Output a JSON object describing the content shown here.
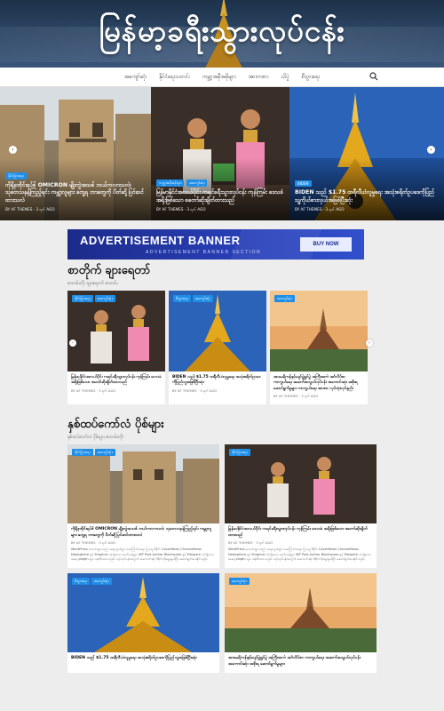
{
  "site": {
    "title": "မြန်မာ့ခရီးသွားလုပ်ငန်း"
  },
  "nav": {
    "items": [
      "အကျော်ဆုံး",
      "နိုင်ငံရေးသတင်း",
      "ကမ္ဘာ့အမှီအခိုများ",
      "အားကစား",
      "သိပ္ပံ",
      "စီးပွားရေး"
    ]
  },
  "slider": {
    "slides": [
      {
        "tags": [
          "နိုင်ငံခြားရေး"
        ],
        "title": "ကိုရိုနာဗိုင်းရပ်စ် OMICRON မျိုးကွဲအသစ် ဘယ်ကလာသလဲ၊ သုတေသနနဲ့ကြည့်ရင်း ကမ္ဘာ့လူများ တွေ့ရ ဘာတွေကို ပိတ်ဆို့ပြင်ဆင်ထားသလဲ",
        "meta": "BY AF THEMES · 3 ရက် AGO"
      },
      {
        "tags": [
          "ကမ္ဘာ့အမှီအခိုများ",
          "အကျော်ဆုံး"
        ],
        "title": "မြန်မာနိုင်ငံအလယ်ပိုင်း ကရင်ခရီးသွားလုပ်ငန်း ကုန်ကြမ်း ဒေသခံ အရိုးဖြစ်သော စတော်ဆိုးချိတ်ထားသည်",
        "meta": "BY AF THEMES · 3 ရက် AGO"
      },
      {
        "tags": [
          "BIDEN"
        ],
        "title": "BIDEN သည် $1.75 ထရီလီယံလူမှုရေး အသုံးစရိတ်ဥပဒေကိုပြည်သူ့ကိုယ်စားလှယ်အဖြစ်ပြီးဆုံး",
        "meta": "BY AF THEMES · 3 ရက် AGO"
      }
    ]
  },
  "ad": {
    "heading": "ADVERTISEMENT BANNER",
    "sub": "ADVERTISEMENT BANNER SECTION",
    "button": "BUY NOW"
  },
  "trending": {
    "title": "စာတိုက် ချားရေတာ်",
    "subtitle": "စာတမ်းတိုး ချားရေတာ် စာတမ်း",
    "cards": [
      {
        "tags": [
          "နိုင်ငံခြားရေး",
          "အကျော်ဆုံး"
        ],
        "title": "မြန်မာနိုင်ငံအလယ်ပိုင်း ကရင်ခရီးသွားလုပ်ငန်း ကုန်ကြမ်း ဒေသခံ အရိုးဖြစ်သော စတော်ဆိုးချိတ်ထားသည်",
        "meta": "BY AF THEMES · 3 ရက် AGO"
      },
      {
        "tags": [
          "စီးပွားရေး",
          "အကျော်ဆုံး"
        ],
        "title": "BIDEN သည် $1.75 ထရီလီယံလူမှုရေး အသုံးစရိတ်ဥပဒေကိုပြည်သူ့အဖြစ်ပြီးဆုံး",
        "meta": "BY AF THEMES · 3 ရက် AGO"
      },
      {
        "tags": [
          "အကျော်ဆုံး"
        ],
        "title": "အာမေရိကန်နှင့်ပျော်ပွဲရွှင်ပွဲ အကြီးအကဲ အင်္ဂလိပ်စာ ကာကွယ်ရေး အဆက်အသွယ်လုပ်ငန်း အကောင်းဆုံး အစိုးရ ဆောင်ရွက်မှုများ ကာကွယ်ရေး အာဏာ လုပ်ထုံးလုပ်နည်း",
        "meta": "BY AF THEMES · 3 ရက် AGO"
      }
    ]
  },
  "latest": {
    "title": "နှစ်ထပ်ကော်လံ ပိုစ်များ",
    "subtitle": "နှစ်ထပ်ကော်လံ ပိုစ်များ စာတမ်းတိုး",
    "cards": [
      {
        "tags": [
          "နိုင်ငံခြားရေး",
          "အကျော်ဆုံး"
        ],
        "title": "ကိုရိုနာဗိုင်းရပ်စ် OMICRON မျိုးကွဲအသစ် ဘယ်ကလာသလဲ၊ သုတေသနနဲ့ကြည့်ရင်း ကမ္ဘာ့လူများ တွေ့ရ ဘာတွေကို ပိတ်ဆို့ပြင်ဆင်ထားသလဲ",
        "meta": "BY AF THEMES · 3 ရက် AGO",
        "excerpt": "WordPress ကောင်းများသည် ပရောဂျက်များ အကြောင်းအရာ ပြသမှု ဒီဇိုင်း CoverNews ChromeNews Newsphere နှင့် Shopical ကဲ့သို့သော ထုတ်ကုန်များ WP Post Author Blockspare နှင့် Elespare ကဲ့သို့သော အခမဲ့ plugin များ ဖန်တီးထားသည်။ သင့်လုပ်ငန်းအတွက် အကောင်းဆုံး ဒီဇိုင်းကိုရွေးချယ်ပြီး ဆောင်ရွက်ပေးနိုင်သည်။"
      },
      {
        "tags": [
          "နိုင်ငံခြားရေး"
        ],
        "title": "မြန်မာနိုင်ငံအလယ်ပိုင်း ကရင်ခရီးသွားလုပ်ငန်း ကုန်ကြမ်း ဒေသခံ အရိုးဖြစ်သော စတော်ဆိုးချိတ်ထားသည်",
        "meta": "BY AF THEMES · 3 ရက် AGO",
        "excerpt": "WordPress ကောင်းများသည် ပရောဂျက်များ အကြောင်းအရာ ပြသမှု ဒီဇိုင်း CoverNews ChromeNews Newsphere နှင့် Shopical ကဲ့သို့သော ထုတ်ကုန်များ WP Post Author Blockspare နှင့် Elespare ကဲ့သို့သော အခမဲ့ plugin များ ဖန်တီးထားသည်။ သင့်လုပ်ငန်းအတွက် အကောင်းဆုံး ဒီဇိုင်းကိုရွေးချယ်ပြီး ဆောင်ရွက်ပေးနိုင်သည်။"
      },
      {
        "tags": [
          "စီးပွားရေး",
          "အကျော်ဆုံး"
        ],
        "title": "BIDEN သည် $1.75 ထရီလီယံလူမှုရေး အသုံးစရိတ်ဥပဒေကိုပြည်သူ့အဖြစ်ပြီးဆုံး",
        "meta": "",
        "excerpt": ""
      },
      {
        "tags": [
          "အကျော်ဆုံး"
        ],
        "title": "အာမေရိကန်နှင့်ပျော်ပွဲရွှင်ပွဲ အကြီးအကဲ အင်္ဂလိပ်စာ ကာကွယ်ရေး အဆက်အသွယ်လုပ်ငန်း အကောင်းဆုံး အစိုးရ ဆောင်ရွက်မှုများ",
        "meta": "",
        "excerpt": ""
      }
    ]
  }
}
